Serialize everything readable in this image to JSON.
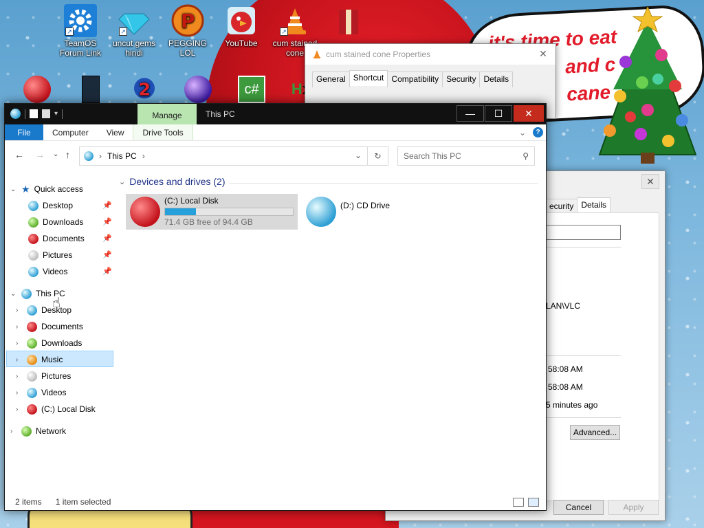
{
  "desktop": {
    "icons": [
      {
        "label": "TeamOS Forum Link",
        "icon": "gear-icon"
      },
      {
        "label": "uncut gems hindi",
        "icon": "diamond-icon"
      },
      {
        "label": "PEGGING LOL",
        "icon": "pinball-p-icon"
      },
      {
        "label": "YouTube",
        "icon": "angry-bird-icon"
      },
      {
        "label": "cum stained cone",
        "icon": "vlc-cone-icon"
      },
      {
        "label": "",
        "icon": "gift-box-icon"
      }
    ],
    "second_row_icons": [
      "recycle-ornament-icon",
      "book-icon",
      "number-2-icon",
      "purple-ornament-icon",
      "csharp-icon",
      "hx-icon"
    ],
    "bubble_lines": [
      "it's time to eat",
      "and c",
      "cane"
    ]
  },
  "properties_top": {
    "title": "cum stained cone Properties",
    "tabs": [
      "General",
      "Shortcut",
      "Compatibility",
      "Security",
      "Details"
    ],
    "active_tab": "Shortcut",
    "partial_name": "cum stained cone",
    "close_label": "✕"
  },
  "properties_back": {
    "close_label": "✕",
    "tabs": [
      "ecurity",
      "Details"
    ],
    "target_text": "LAN\\VLC",
    "created": "58:08 AM",
    "modified": "58:08 AM",
    "accessed": "5 minutes ago",
    "advanced_label": "Advanced...",
    "cancel_label": "Cancel",
    "apply_label": "Apply"
  },
  "explorer": {
    "title": "This PC",
    "manage_label": "Manage",
    "ribbon": {
      "file": "File",
      "tabs": [
        "Computer",
        "View"
      ],
      "drive_tools": "Drive Tools",
      "expand": "⌄",
      "help": "?"
    },
    "address": {
      "segments": [
        "This PC"
      ],
      "search_placeholder": "Search This PC"
    },
    "nav": {
      "quick_access": "Quick access",
      "quick_items": [
        {
          "label": "Desktop",
          "color": "o-blue"
        },
        {
          "label": "Downloads",
          "color": "o-green"
        },
        {
          "label": "Documents",
          "color": "o-red"
        },
        {
          "label": "Pictures",
          "color": "o-white"
        },
        {
          "label": "Videos",
          "color": "o-blue"
        }
      ],
      "this_pc": "This PC",
      "pc_items": [
        {
          "label": "Desktop",
          "color": "o-blue"
        },
        {
          "label": "Documents",
          "color": "o-red"
        },
        {
          "label": "Downloads",
          "color": "o-green"
        },
        {
          "label": "Music",
          "color": "o-orange"
        },
        {
          "label": "Pictures",
          "color": "o-white"
        },
        {
          "label": "Videos",
          "color": "o-blue"
        },
        {
          "label": "(C:) Local Disk",
          "color": "o-red"
        }
      ],
      "network": "Network"
    },
    "content": {
      "group_title": "Devices and drives (2)",
      "drives": [
        {
          "name": "(C:) Local Disk",
          "free": "71.4 GB free of 94.4 GB",
          "used_fraction": 0.244
        },
        {
          "name": "(D:) CD Drive"
        }
      ]
    },
    "status": {
      "items": "2 items",
      "selected": "1 item selected"
    }
  },
  "colors": {
    "accent": "#1979ca",
    "manage_tab": "#b9e5b0",
    "close_red": "#c42b1c",
    "selection": "#cce8ff",
    "progress": "#26a0da"
  }
}
